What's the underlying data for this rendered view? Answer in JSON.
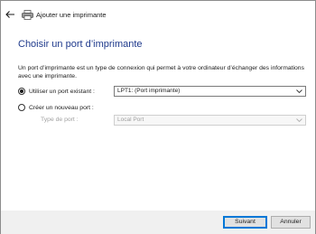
{
  "window": {
    "title": "Ajouter une imprimante"
  },
  "page": {
    "heading": "Choisir un port d’imprimante",
    "description": "Un port d’imprimante est un type de connexion qui permet à votre ordinateur d’échanger des informations avec une imprimante."
  },
  "options": {
    "existing_port": {
      "label": "Utiliser un port existant :",
      "selected": true,
      "value": "LPT1: (Port imprimante)"
    },
    "new_port": {
      "label": "Créer un nouveau port :",
      "selected": false,
      "type_label": "Type de port :",
      "type_value": "Local Port"
    }
  },
  "footer": {
    "next_label": "Suivant",
    "cancel_label": "Annuler"
  },
  "colors": {
    "heading": "#1f3a8c",
    "primary_border": "#0078d7",
    "footer_bg": "#f0f0f0"
  },
  "icons": {
    "back": "back-arrow-icon",
    "printer": "printer-icon",
    "dropdown": "chevron-down-icon"
  }
}
